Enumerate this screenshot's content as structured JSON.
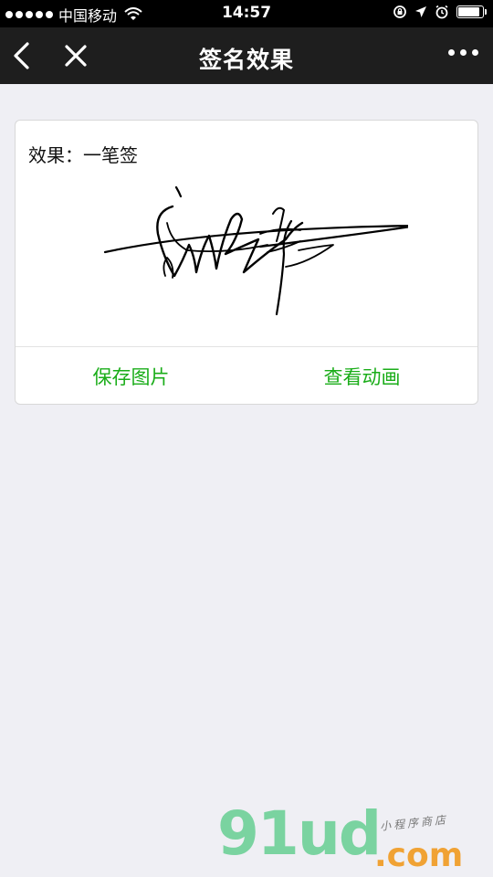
{
  "status_bar": {
    "carrier": "中国移动",
    "time": "14:57",
    "battery_level": 0.9
  },
  "nav": {
    "title": "签名效果",
    "back_icon": "chevron-left-icon",
    "close_icon": "close-icon",
    "more_icon": "more-dots-icon"
  },
  "card": {
    "label": "效果：一笔签",
    "save_label": "保存图片",
    "animate_label": "查看动画"
  },
  "colors": {
    "accent": "#1aad19",
    "nav_bg": "#1e1e1e",
    "page_bg": "#efeff4"
  },
  "watermark": {
    "brand": "91ud",
    "domain_suffix": ".com",
    "subtitle": "小程序商店"
  }
}
